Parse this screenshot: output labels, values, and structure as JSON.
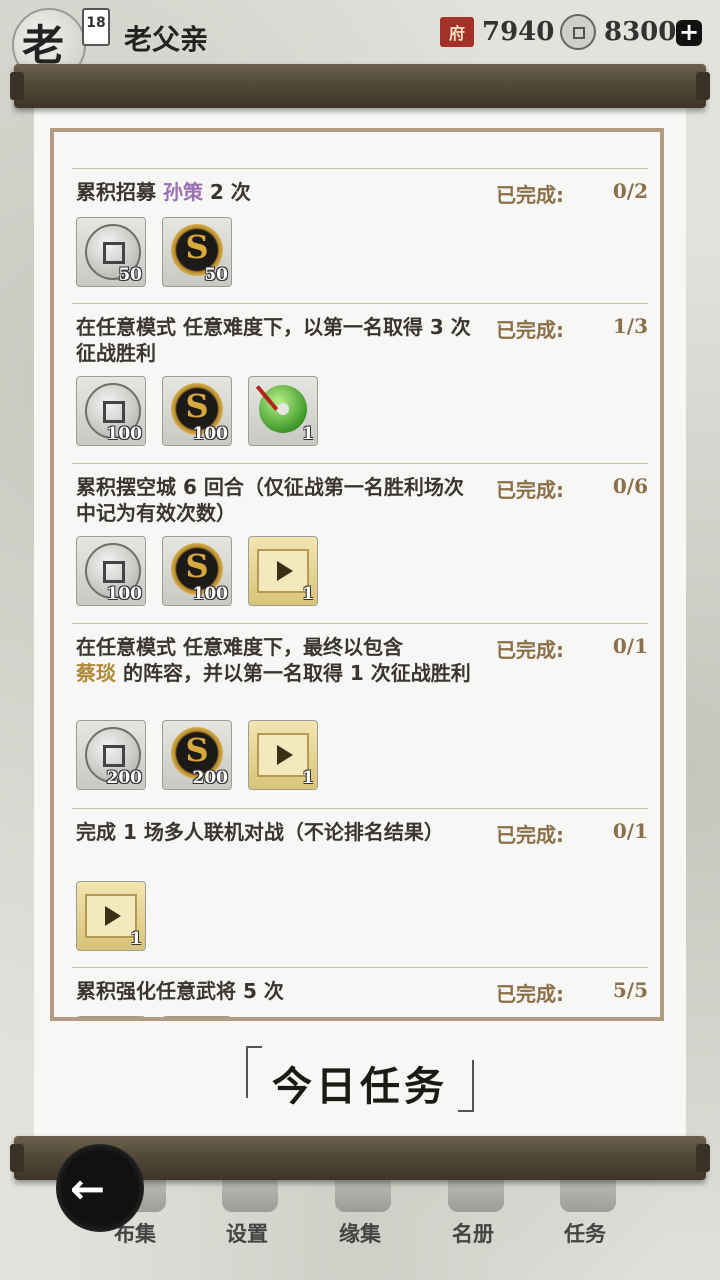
{
  "header": {
    "avatar_char": "老",
    "level": "18",
    "player_name": "老父亲",
    "currency_a_icon": "府",
    "currency_a": "7940",
    "currency_b": "8300",
    "plus": "+"
  },
  "status_label": "已完成:",
  "tasks": [
    {
      "parts": [
        "",
        "",
        "",
        "",
        ""
      ],
      "progress": "",
      "rewards": [
        {
          "type": "silver-coin-icon",
          "qty": "50"
        },
        {
          "type": "gold-coin-icon",
          "qty": "50"
        }
      ]
    },
    {
      "parts": [
        "累积招募 ",
        "孙策",
        " 2 次",
        "",
        ""
      ],
      "progress": "0/2",
      "rewards": [
        {
          "type": "silver-coin-icon",
          "qty": "50"
        },
        {
          "type": "gold-coin-icon",
          "qty": "50"
        }
      ]
    },
    {
      "parts": [
        "在任意模式 任意难度下，以第一名取得 3 次征战胜利",
        "",
        "",
        "",
        ""
      ],
      "progress": "1/3",
      "rewards": [
        {
          "type": "silver-coin-icon",
          "qty": "100"
        },
        {
          "type": "gold-coin-icon",
          "qty": "100"
        },
        {
          "type": "jade-pendant-icon",
          "qty": "1"
        }
      ]
    },
    {
      "parts": [
        "累积摆空城 6 回合（仅征战第一名胜利场次中记为有效次数）",
        "",
        "",
        "",
        ""
      ],
      "progress": "0/6",
      "rewards": [
        {
          "type": "silver-coin-icon",
          "qty": "100"
        },
        {
          "type": "gold-coin-icon",
          "qty": "100"
        },
        {
          "type": "ticket-icon",
          "qty": "1"
        }
      ]
    },
    {
      "parts": [
        "在任意模式 任意难度下，最终以包含",
        "",
        "蔡琰",
        " 的阵容，并以第一名取得 1 次征战胜利",
        ""
      ],
      "progress": "0/1",
      "rewards": [
        {
          "type": "silver-coin-icon",
          "qty": "200"
        },
        {
          "type": "gold-coin-icon",
          "qty": "200"
        },
        {
          "type": "ticket-icon",
          "qty": "1"
        }
      ]
    },
    {
      "parts": [
        "完成 1 场多人联机对战（不论排名结果）",
        "",
        "",
        "",
        ""
      ],
      "progress": "0/1",
      "rewards": [
        {
          "type": "ticket-icon",
          "qty": "1"
        }
      ]
    },
    {
      "parts": [
        "累积强化任意武将 5 次",
        "",
        "",
        "",
        ""
      ],
      "progress": "5/5",
      "rewards": [
        {
          "type": "silver-coin-icon",
          "qty": ""
        },
        {
          "type": "gold-coin-icon",
          "qty": ""
        }
      ]
    }
  ],
  "title": "今日任务",
  "nav": [
    "布集",
    "设置",
    "缘集",
    "名册",
    "任务"
  ],
  "back_icon": "back-arrow-icon"
}
